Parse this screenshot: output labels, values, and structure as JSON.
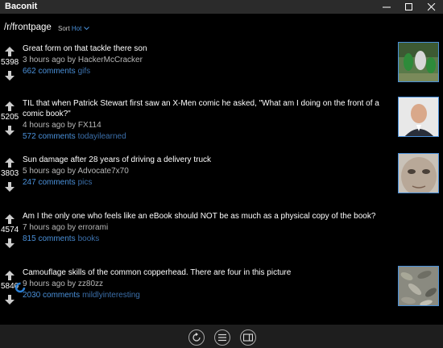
{
  "app": {
    "title": "Baconit"
  },
  "window_controls": [
    "minimize-icon",
    "maximize-icon",
    "close-icon"
  ],
  "header": {
    "subreddit": "/r/frontpage",
    "sort_label": "Sort",
    "sort_value": "Hot"
  },
  "colors": {
    "accent": "#4a90d9",
    "background": "#000000",
    "titlebar": "#2b2b2b"
  },
  "posts": [
    {
      "score": "5398",
      "title": "Great form on that tackle there son",
      "meta": "3 hours ago by HackerMcCracker",
      "comments": "662 comments",
      "subreddit": "gifs",
      "thumbnail": "football-players-thumbnail"
    },
    {
      "score": "5205",
      "title": "TIL that when Patrick Stewart first saw an X-Men comic he asked, \"What am I doing on the front of a comic book?\"",
      "meta": "4 hours ago by FX114",
      "comments": "572 comments",
      "subreddit": "todayilearned",
      "thumbnail": "man-portrait-thumbnail"
    },
    {
      "score": "3803",
      "title": "Sun damage after 28 years of driving a delivery truck",
      "meta": "5 hours ago by Advocate7x70",
      "comments": "247 comments",
      "subreddit": "pics",
      "thumbnail": "face-closeup-thumbnail"
    },
    {
      "score": "4574",
      "title": "Am I the only one who feels like an eBook should NOT be as much as a physical copy of the book?",
      "meta": "7 hours ago by errorami",
      "comments": "815 comments",
      "subreddit": "books",
      "thumbnail": ""
    },
    {
      "score": "5840",
      "title": "Camouflage skills of the common copperhead. There are four in this picture",
      "meta": "9 hours ago by zz80zz",
      "comments": "2030 comments",
      "subreddit": "mildlyinteresting",
      "thumbnail": "leaves-thumbnail"
    }
  ],
  "bottom_bar": [
    "refresh-icon",
    "menu-icon",
    "panel-icon"
  ]
}
